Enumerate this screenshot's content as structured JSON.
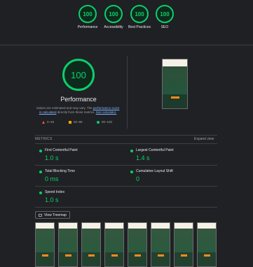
{
  "category_gauges": [
    {
      "score": "100",
      "label": "Performance"
    },
    {
      "score": "100",
      "label": "Accessibility"
    },
    {
      "score": "100",
      "label": "Best Practices"
    },
    {
      "score": "100",
      "label": "SEO"
    }
  ],
  "performance": {
    "score": "100",
    "title": "Performance",
    "desc_prefix": "Values are estimated and may vary. The ",
    "desc_link1": "performance score is calculated",
    "desc_mid": " directly from these metrics. ",
    "desc_link2": "See calculator."
  },
  "legend": {
    "fail": "0–49",
    "average": "50–89",
    "pass": "90–100"
  },
  "metrics_header": {
    "label": "METRICS",
    "expand": "Expand view"
  },
  "metrics": [
    {
      "name": "First Contentful Paint",
      "value": "1.0 s"
    },
    {
      "name": "Largest Contentful Paint",
      "value": "1.4 s"
    },
    {
      "name": "Total Blocking Time",
      "value": "0 ms"
    },
    {
      "name": "Cumulative Layout Shift",
      "value": "0"
    },
    {
      "name": "Speed Index",
      "value": "1.0 s"
    }
  ],
  "treemap": {
    "label": "View Treemap"
  },
  "colors": {
    "pass": "#0cce6b",
    "average": "#ffa400",
    "fail": "#ff4e42",
    "background": "#202124"
  }
}
